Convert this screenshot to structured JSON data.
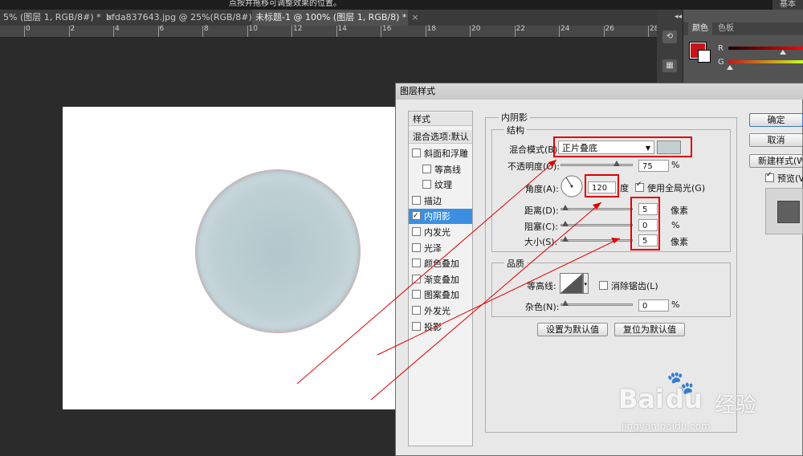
{
  "hint_text": "点按并拖移可调整效果的位置。",
  "workspace": "基本",
  "tabs": [
    {
      "label": "5% (图层 1, RGB/8#) *",
      "close": "×"
    },
    {
      "label": "bfda837643.jpg @ 25%(RGB/8#)",
      "close": "×"
    },
    {
      "label": "未标题-1 @ 100% (图层 1, RGB/8) *",
      "close": "×"
    }
  ],
  "ruler_numbers": [
    "0",
    "2",
    "4",
    "6",
    "8",
    "10",
    "12",
    "14",
    "16",
    "18",
    "20",
    "22",
    "24",
    "26",
    "28"
  ],
  "right_panel": {
    "collapse": "◂◂",
    "tab_color": "颜色",
    "tab_swatches": "色板",
    "channel_r": "R",
    "channel_g": "G",
    "fg_color": "#c8141b",
    "bg_color": "#ffffff"
  },
  "dialog": {
    "title": "图层样式",
    "styles_header": "样式",
    "blend_options": "混合选项:默认",
    "styles": [
      {
        "label": "斜面和浮雕",
        "checked": false,
        "indent": false
      },
      {
        "label": "等高线",
        "checked": false,
        "indent": true
      },
      {
        "label": "纹理",
        "checked": false,
        "indent": true
      },
      {
        "label": "描边",
        "checked": false,
        "indent": false
      },
      {
        "label": "内阴影",
        "checked": true,
        "indent": false,
        "selected": true
      },
      {
        "label": "内发光",
        "checked": false,
        "indent": false
      },
      {
        "label": "光泽",
        "checked": false,
        "indent": false
      },
      {
        "label": "颜色叠加",
        "checked": false,
        "indent": false
      },
      {
        "label": "渐变叠加",
        "checked": false,
        "indent": false
      },
      {
        "label": "图案叠加",
        "checked": false,
        "indent": false
      },
      {
        "label": "外发光",
        "checked": false,
        "indent": false
      },
      {
        "label": "投影",
        "checked": false,
        "indent": false
      }
    ],
    "section_title": "内阴影",
    "structure_title": "结构",
    "blend_mode_label": "混合模式(B):",
    "blend_mode_value": "正片叠底",
    "shadow_color": "#c4cfd2",
    "opacity_label": "不透明度(O):",
    "opacity_value": "75",
    "percent": "%",
    "angle_label": "角度(A):",
    "angle_value": "120",
    "angle_unit": "度",
    "global_light_label": "使用全局光(G)",
    "global_light": true,
    "distance_label": "距离(D):",
    "distance_value": "5",
    "choke_label": "阻塞(C):",
    "choke_value": "0",
    "size_label": "大小(S):",
    "size_value": "5",
    "pixels": "像素",
    "quality_title": "品质",
    "contour_label": "等高线:",
    "antialias_label": "消除锯齿(L)",
    "noise_label": "杂色(N):",
    "noise_value": "0",
    "set_default": "设置为默认值",
    "reset_default": "复位为默认值",
    "ok": "确定",
    "cancel": "取消",
    "new_style": "新建样式(W)...",
    "preview_label": "预览(V)",
    "preview": true
  },
  "watermark": {
    "brand": "Bai",
    "brand2": "du",
    "cn": "经验",
    "url": "jingyan.baidu.com"
  }
}
